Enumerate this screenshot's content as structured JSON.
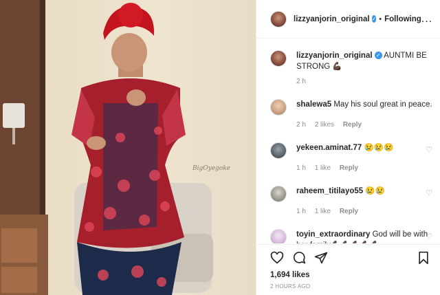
{
  "post": {
    "photo_alt": "Woman in red and navy lace outfit with red gele",
    "watermark": "BigOyegoke"
  },
  "header": {
    "username": "lizzyanjorin_original",
    "separator": "•",
    "follow_label": "Following",
    "more_label": "..."
  },
  "caption": {
    "username": "lizzyanjorin_original",
    "text": " AUNTMI BE STRONG 💪🏿",
    "time": "2 h"
  },
  "comments": [
    {
      "username": "shalewa5",
      "text": " May his soul great in peace.",
      "time": "2 h",
      "likes": "2 likes",
      "reply": "Reply"
    },
    {
      "username": "yekeen.aminat.77",
      "text": " 😢😢😢",
      "time": "1 h",
      "likes": "1 like",
      "reply": "Reply"
    },
    {
      "username": "raheem_titilayo55",
      "text": " 😢😢",
      "time": "1 h",
      "likes": "1 like",
      "reply": "Reply"
    },
    {
      "username": "toyin_extraordinary",
      "text": " God will be with her family💪🏿💪🏿💪🏿💪🏿💪🏿",
      "time": "",
      "likes": "",
      "reply": ""
    }
  ],
  "actions": {
    "likes": "1,694 likes",
    "timestamp": "2 HOURS AGO"
  },
  "icons": [
    "heart-icon",
    "comment-icon",
    "share-icon",
    "bookmark-icon",
    "verified-badge-icon"
  ],
  "colors": {
    "verified": "#3897f0",
    "muted": "#8e8e8e",
    "text": "#262626"
  }
}
